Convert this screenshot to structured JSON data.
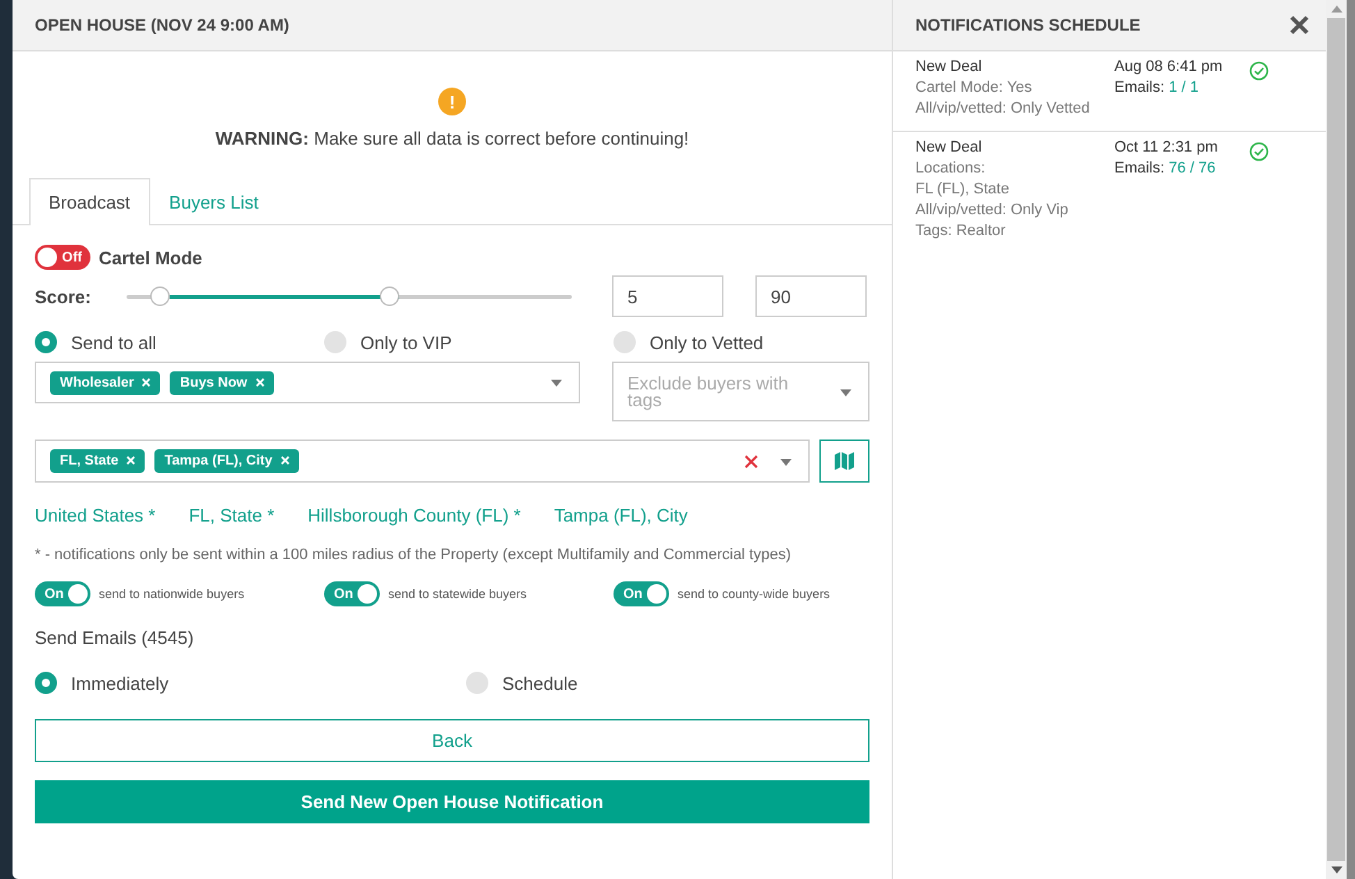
{
  "modal": {
    "title": "OPEN HOUSE (NOV 24 9:00 AM)",
    "warning": {
      "icon": "!",
      "text": "**WARNING:** Make sure all data is correct before continuing!"
    },
    "tabs": [
      {
        "label": "Broadcast",
        "selected": true
      },
      {
        "label": "Buyers List",
        "selected": false
      }
    ],
    "cartel_mode": {
      "label": "Cartel Mode",
      "on": false,
      "toggle_text": "Off"
    },
    "score": {
      "label": "Score:",
      "thumbs": [
        {
          "level": 0.094
        },
        {
          "level": 0.588
        }
      ],
      "min_value": "5",
      "max_value": "90"
    },
    "audience": [
      {
        "label": "Send to all",
        "selected": true
      },
      {
        "label": "Only to VIP",
        "selected": false
      },
      {
        "label": "Only to Vetted",
        "selected": false
      }
    ],
    "tag_select": {
      "tags": [
        "Wholesaler",
        "Buys Now"
      ]
    },
    "exclude_select": {
      "placeholder": "Exclude buyers with tags"
    },
    "location_select": {
      "tags": [
        "FL, State",
        "Tampa (FL), City"
      ]
    },
    "location_links": [
      "United States *",
      "FL, State *",
      "Hillsborough County (FL) *",
      "Tampa (FL), City"
    ],
    "note": "* - notifications only be sent within a 100 miles radius of the Property (except Multifamily and Commercial types)",
    "scope_toggles": [
      {
        "toggle_text": "On",
        "on": true,
        "label": "send to nationwide buyers"
      },
      {
        "toggle_text": "On",
        "on": true,
        "label": "send to statewide buyers"
      },
      {
        "toggle_text": "On",
        "on": true,
        "label": "send to county-wide buyers"
      }
    ],
    "send_emails": "Send Emails (4545)",
    "timing": [
      {
        "label": "Immediately",
        "selected": true
      },
      {
        "label": "Schedule",
        "selected": false
      }
    ],
    "back_button": "Back",
    "submit_button": "Send New Open House Notification"
  },
  "schedule": {
    "title": "NOTIFICATIONS SCHEDULE",
    "items": [
      {
        "title": "New Deal",
        "lines": [
          "Cartel Mode: Yes",
          "All/vip/vetted: Only Vetted"
        ],
        "date": "Aug 08 6:41 pm",
        "emails_label": "Emails:",
        "emails_count": "1 / 1",
        "done": true
      },
      {
        "title": "New Deal",
        "lines": [
          "Locations:",
          "FL (FL), State",
          "All/vip/vetted: Only Vip",
          "Tags: Realtor"
        ],
        "date": "Oct 11 2:31 pm",
        "emails_label": "Emails:",
        "emails_count": "76 / 76",
        "done": true
      }
    ]
  }
}
